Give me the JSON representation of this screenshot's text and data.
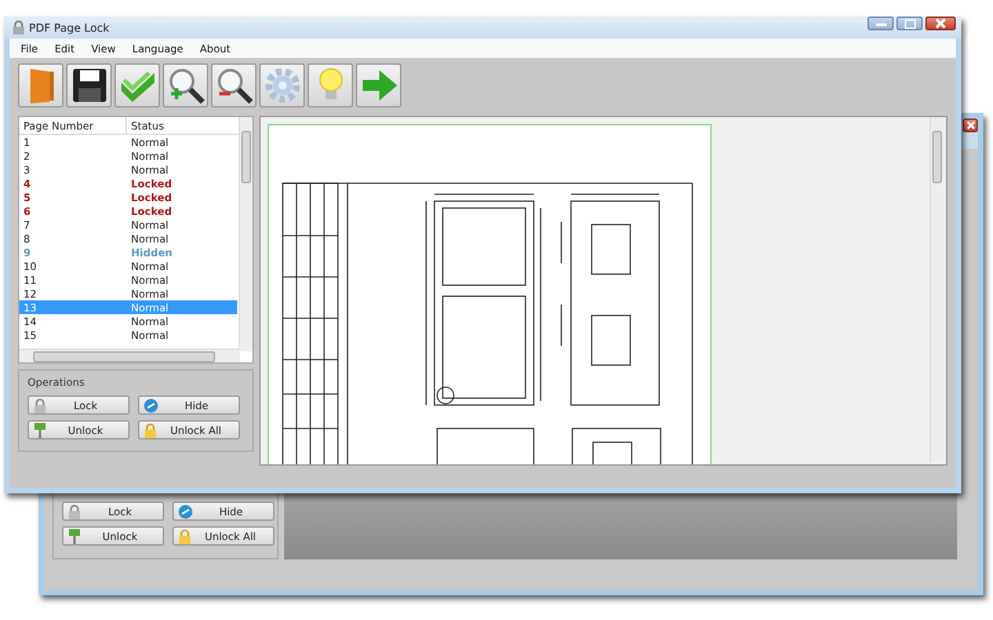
{
  "window": {
    "title": "PDF Page Lock"
  },
  "menu": [
    "File",
    "Edit",
    "View",
    "Language",
    "About"
  ],
  "table": {
    "columns": [
      "Page Number",
      "Status"
    ],
    "rows": [
      {
        "page": "1",
        "status": "Normal",
        "kind": "normal",
        "selected": false
      },
      {
        "page": "2",
        "status": "Normal",
        "kind": "normal",
        "selected": false
      },
      {
        "page": "3",
        "status": "Normal",
        "kind": "normal",
        "selected": false
      },
      {
        "page": "4",
        "status": "Locked",
        "kind": "locked",
        "selected": false
      },
      {
        "page": "5",
        "status": "Locked",
        "kind": "locked",
        "selected": false
      },
      {
        "page": "6",
        "status": "Locked",
        "kind": "locked",
        "selected": false
      },
      {
        "page": "7",
        "status": "Normal",
        "kind": "normal",
        "selected": false
      },
      {
        "page": "8",
        "status": "Normal",
        "kind": "normal",
        "selected": false
      },
      {
        "page": "9",
        "status": "Hidden",
        "kind": "hidden",
        "selected": false
      },
      {
        "page": "10",
        "status": "Normal",
        "kind": "normal",
        "selected": false
      },
      {
        "page": "11",
        "status": "Normal",
        "kind": "normal",
        "selected": false
      },
      {
        "page": "12",
        "status": "Normal",
        "kind": "normal",
        "selected": false
      },
      {
        "page": "13",
        "status": "Normal",
        "kind": "normal",
        "selected": true
      },
      {
        "page": "14",
        "status": "Normal",
        "kind": "normal",
        "selected": false
      },
      {
        "page": "15",
        "status": "Normal",
        "kind": "normal",
        "selected": false
      }
    ]
  },
  "operations": {
    "title": "Operations",
    "buttons": [
      {
        "label": "Lock",
        "kind": "lock"
      },
      {
        "label": "Hide",
        "kind": "hide"
      },
      {
        "label": "Unlock",
        "kind": "unlock"
      },
      {
        "label": "Unlock All",
        "kind": "unlock_all"
      }
    ]
  },
  "background_window": {
    "buttons": [
      {
        "label": "Lock",
        "kind": "lock"
      },
      {
        "label": "Hide",
        "kind": "hide"
      },
      {
        "label": "Unlock",
        "kind": "unlock"
      },
      {
        "label": "Unlock All",
        "kind": "unlock_all"
      }
    ]
  }
}
